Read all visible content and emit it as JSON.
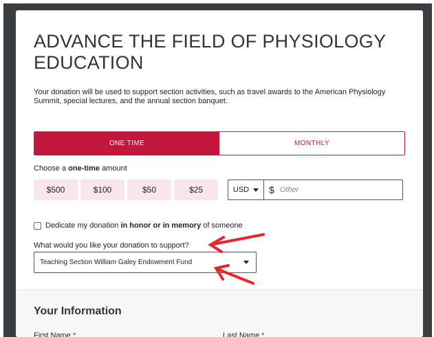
{
  "page": {
    "title": "ADVANCE THE FIELD OF PHYSIOLOGY EDUCATION",
    "description": "Your donation will be used to support section activities, such as travel awards to the American Physiology Summit, special lectures, and the annual section banquet."
  },
  "frequency": {
    "one_time_label": "ONE TIME",
    "monthly_label": "MONTHLY",
    "selected": "ONE TIME"
  },
  "amount": {
    "choose_prefix": "Choose a",
    "choose_bold": "one-time",
    "choose_suffix": "amount",
    "options": [
      "$500",
      "$100",
      "$50",
      "$25"
    ],
    "currency": "USD",
    "currency_symbol": "$",
    "other_placeholder": "Other"
  },
  "dedicate": {
    "prefix": "Dedicate my donation",
    "bold": "in honor or in memory",
    "suffix": "of someone",
    "checked": false
  },
  "support": {
    "question": "What would you like your donation to support?",
    "selected": "Teaching Section William Galey Endowment Fund"
  },
  "your_info": {
    "title": "Your Information",
    "first_name_label": "First Name",
    "last_name_label": "Last Name",
    "required_marker": "*"
  },
  "colors": {
    "accent": "#c2183d",
    "annotation_arrow": "#e8262b",
    "amount_bg": "#f9e6ea",
    "frame": "#3a3d40"
  }
}
